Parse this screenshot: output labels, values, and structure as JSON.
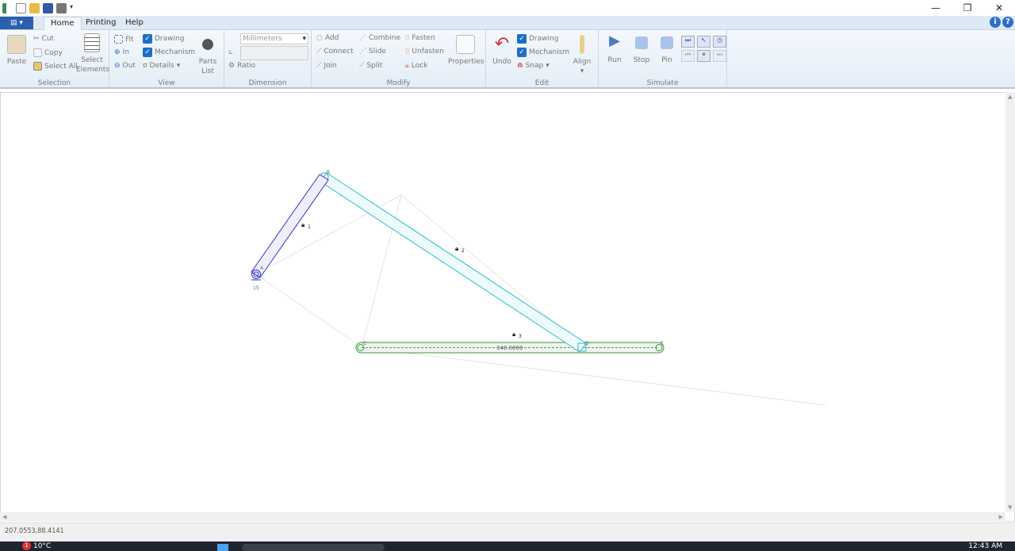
{
  "quick_access": [
    "app-logo-icon",
    "new-icon",
    "open-icon",
    "save-icon",
    "print-icon",
    "customize-icon"
  ],
  "window_controls": {
    "minimize": "—",
    "restore": "❐",
    "close": "✕"
  },
  "tabs": [
    {
      "label": "Home",
      "active": true
    },
    {
      "label": "Printing"
    },
    {
      "label": "Help"
    }
  ],
  "ribbon": {
    "selection": {
      "label": "Selection",
      "paste": "Paste",
      "cut": "Cut",
      "copy": "Copy",
      "select_all": "Select All",
      "select_elements": "Select Elements"
    },
    "view": {
      "label": "View",
      "fit": "Fit",
      "in": "In",
      "out": "Out",
      "drawing": "Drawing",
      "mechanism": "Mechanism",
      "details": "Details",
      "parts_list": "Parts List",
      "drawing_checked": true,
      "mechanism_checked": true
    },
    "dimension": {
      "label": "Dimension",
      "units": "Millimeters",
      "value": "",
      "ratio": "Ratio"
    },
    "modify": {
      "label": "Modify",
      "add": "Add",
      "connect": "Connect",
      "join": "Join",
      "combine": "Combine",
      "slide": "Slide",
      "split": "Split",
      "fasten": "Fasten",
      "unfasten": "Unfasten",
      "lock": "Lock",
      "properties": "Properties"
    },
    "edit": {
      "label": "Edit",
      "undo": "Undo",
      "drawing": "Drawing",
      "mechanism": "Mechanism",
      "snap": "Snap",
      "align": "Align",
      "drawing_checked": true,
      "mechanism_checked": true
    },
    "simulate": {
      "label": "Simulate",
      "run": "Run",
      "stop": "Stop",
      "pin": "Pin"
    }
  },
  "drawing": {
    "points": {
      "A": "A",
      "B": "B",
      "C": "C",
      "D": "D",
      "E": "E"
    },
    "ground_label": "15",
    "links": [
      "1",
      "2",
      "3"
    ],
    "dimension": "340.0000",
    "colors": {
      "link1": "#3333cc",
      "link2": "#2bbcd0",
      "link3": "#3a9a3a"
    }
  },
  "status": {
    "coords": "207.0553,88.4141"
  },
  "taskbar": {
    "weather": "10°C",
    "time": "12:43 AM",
    "notification_badge": "1"
  }
}
